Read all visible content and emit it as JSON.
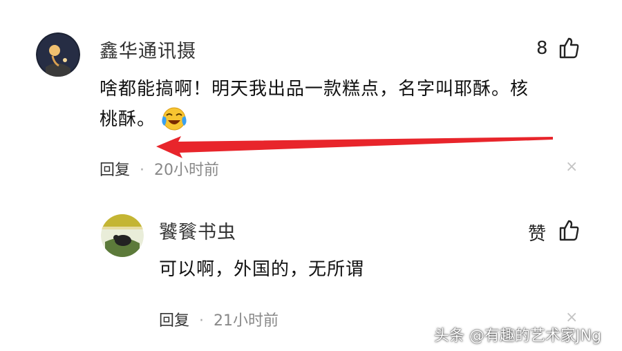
{
  "comment": {
    "author": "鑫华通讯摄",
    "likes": "8",
    "text_line1": "啥都能搞啊！明天我出品一款糕点，名字叫耶酥。核",
    "text_line2": "桃酥。",
    "emoji": "crying-laughing-emoji",
    "reply_label": "回复",
    "separator": "·",
    "time": "20小时前",
    "close": "×"
  },
  "reply": {
    "author": "饕餮书虫",
    "like_label": "赞",
    "text": "可以啊，外国的，无所谓",
    "reply_label": "回复",
    "separator": "·",
    "time": "21小时前",
    "close": "×"
  },
  "annotation": {
    "type": "red-arrow",
    "color": "#e8252b"
  },
  "watermark": "头条 @有趣的艺术家JNg"
}
